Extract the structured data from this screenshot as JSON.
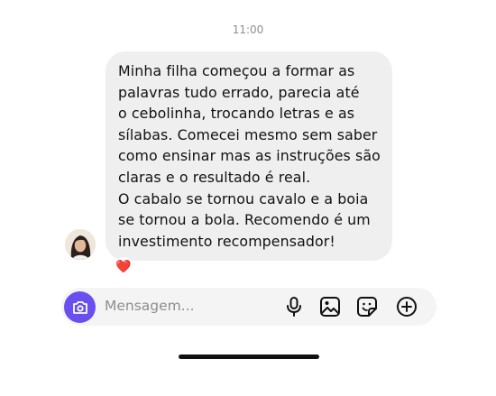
{
  "status": {
    "time": "11:00"
  },
  "message": {
    "text": "Minha filha começou a formar as\npalavras tudo errado, parecia até\no cebolinha, trocando letras e as\nsílabas. Comecei mesmo sem saber\ncomo ensinar mas as instruções são\nclaras e o resultado é real.\nO cabalo se tornou cavalo e a boia\nse tornou a bola. Recomendo é um\ninvestimento recompensador!",
    "reaction": "❤️"
  },
  "composer": {
    "placeholder": "Mensagem...",
    "accent_color": "#6a4ff0",
    "icons": [
      "camera-icon",
      "microphone-icon",
      "image-icon",
      "sticker-icon",
      "plus-circle-icon"
    ]
  }
}
